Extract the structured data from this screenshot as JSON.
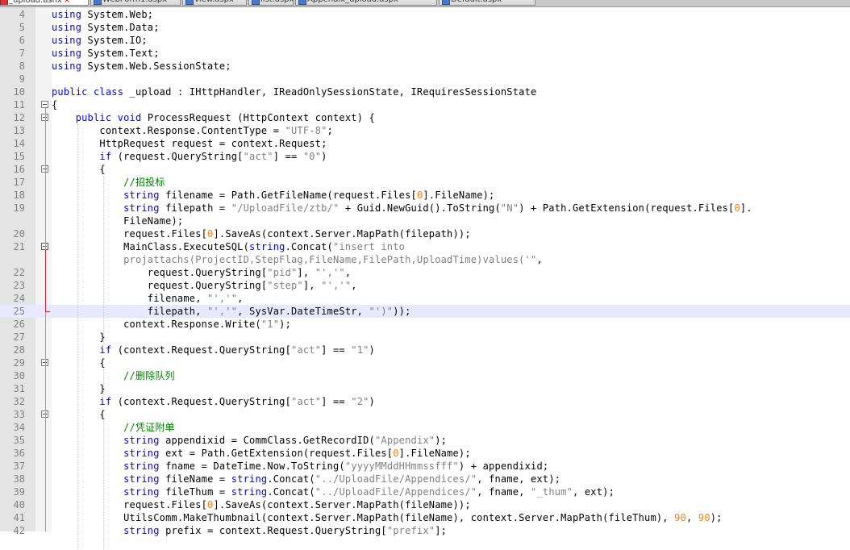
{
  "tabs": [
    {
      "label": "_upload.ashx",
      "active": true
    },
    {
      "label": "WebForm1.aspx",
      "active": false
    },
    {
      "label": "view.aspx",
      "active": false
    },
    {
      "label": "list.aspx",
      "active": false
    },
    {
      "label": "Appendix_upload.aspx",
      "active": false
    },
    {
      "label": "Default.aspx",
      "active": false
    }
  ],
  "editor": {
    "current_line": 25,
    "lines": [
      {
        "num": "4",
        "text": "using System.Web;",
        "fold": "none"
      },
      {
        "num": "5",
        "text": "using System.Data;",
        "fold": "none"
      },
      {
        "num": "6",
        "text": "using System.IO;",
        "fold": "none"
      },
      {
        "num": "7",
        "text": "using System.Text;",
        "fold": "none"
      },
      {
        "num": "8",
        "text": "using System.Web.SessionState;",
        "fold": "none"
      },
      {
        "num": "9",
        "text": "",
        "fold": "none"
      },
      {
        "num": "10",
        "text": "public class _upload : IHttpHandler, IReadOnlySessionState, IRequiresSessionState",
        "fold": "none"
      },
      {
        "num": "11",
        "text": "{",
        "fold": "box"
      },
      {
        "num": "12",
        "text": "    public void ProcessRequest (HttpContext context) {",
        "fold": "box"
      },
      {
        "num": "13",
        "text": "        context.Response.ContentType = \"UTF-8\";",
        "fold": "none"
      },
      {
        "num": "14",
        "text": "        HttpRequest request = context.Request;",
        "fold": "none"
      },
      {
        "num": "15",
        "text": "        if (request.QueryString[\"act\"] == \"0\")",
        "fold": "none"
      },
      {
        "num": "16",
        "text": "        {",
        "fold": "box"
      },
      {
        "num": "17",
        "text": "            //招投标",
        "fold": "none"
      },
      {
        "num": "18",
        "text": "            string filename = Path.GetFileName(request.Files[0].FileName);",
        "fold": "none"
      },
      {
        "num": "19",
        "text": "            string filepath = \"/UploadFile/ztb/\" + Guid.NewGuid().ToString(\"N\") + Path.GetExtension(request.Files[0].",
        "fold": "none"
      },
      {
        "num": "",
        "text": "            FileName);",
        "fold": "none"
      },
      {
        "num": "20",
        "text": "            request.Files[0].SaveAs(context.Server.MapPath(filepath));",
        "fold": "none"
      },
      {
        "num": "21",
        "text": "            MainClass.ExecuteSQL(string.Concat(\"insert into",
        "fold": "redbox"
      },
      {
        "num": "",
        "text": "            projattachs(ProjectID,StepFlag,FileName,FilePath,UploadTime)values('\",",
        "fold": "none"
      },
      {
        "num": "22",
        "text": "                request.QueryString[\"pid\"], \"','\",",
        "fold": "none"
      },
      {
        "num": "23",
        "text": "                request.QueryString[\"step\"], \"','\",",
        "fold": "none"
      },
      {
        "num": "24",
        "text": "                filename, \"','\",",
        "fold": "none"
      },
      {
        "num": "25",
        "text": "                filepath, \"','\", SysVar.DateTimeStr, \"')\"));",
        "fold": "none"
      },
      {
        "num": "26",
        "text": "            context.Response.Write(\"1\");",
        "fold": "none"
      },
      {
        "num": "27",
        "text": "        }",
        "fold": "none"
      },
      {
        "num": "28",
        "text": "        if (context.Request.QueryString[\"act\"] == \"1\")",
        "fold": "none"
      },
      {
        "num": "29",
        "text": "        {",
        "fold": "box"
      },
      {
        "num": "30",
        "text": "            //删除队列",
        "fold": "none"
      },
      {
        "num": "31",
        "text": "        }",
        "fold": "none"
      },
      {
        "num": "32",
        "text": "        if (context.Request.QueryString[\"act\"] == \"2\")",
        "fold": "none"
      },
      {
        "num": "33",
        "text": "        {",
        "fold": "box"
      },
      {
        "num": "34",
        "text": "            //凭证附单",
        "fold": "none"
      },
      {
        "num": "35",
        "text": "            string appendixid = CommClass.GetRecordID(\"Appendix\");",
        "fold": "none"
      },
      {
        "num": "36",
        "text": "            string ext = Path.GetExtension(request.Files[0].FileName);",
        "fold": "none"
      },
      {
        "num": "37",
        "text": "            string fname = DateTime.Now.ToString(\"yyyyMMddHHmmssfff\") + appendixid;",
        "fold": "none"
      },
      {
        "num": "38",
        "text": "            string fileName = string.Concat(\"../UploadFile/Appendices/\", fname, ext);",
        "fold": "none"
      },
      {
        "num": "39",
        "text": "            string fileThum = string.Concat(\"../UploadFile/Appendices/\", fname, \"_thum\", ext);",
        "fold": "none"
      },
      {
        "num": "40",
        "text": "            request.Files[0].SaveAs(context.Server.MapPath(fileName));",
        "fold": "none"
      },
      {
        "num": "41",
        "text": "            UtilsComm.MakeThumbnail(context.Server.MapPath(fileName), context.Server.MapPath(fileThum), 90, 90);",
        "fold": "none"
      },
      {
        "num": "42",
        "text": "            string prefix = context.Request.QueryString[\"prefix\"];",
        "fold": "none"
      }
    ]
  },
  "colors": {
    "keyword": "#0000ff",
    "string": "#808080",
    "number": "#ff8000",
    "comment": "#008000",
    "current_line": "#e8e8ff",
    "gutter": "#e4e4e4",
    "fold_marker_red": "#cc2a2a"
  }
}
